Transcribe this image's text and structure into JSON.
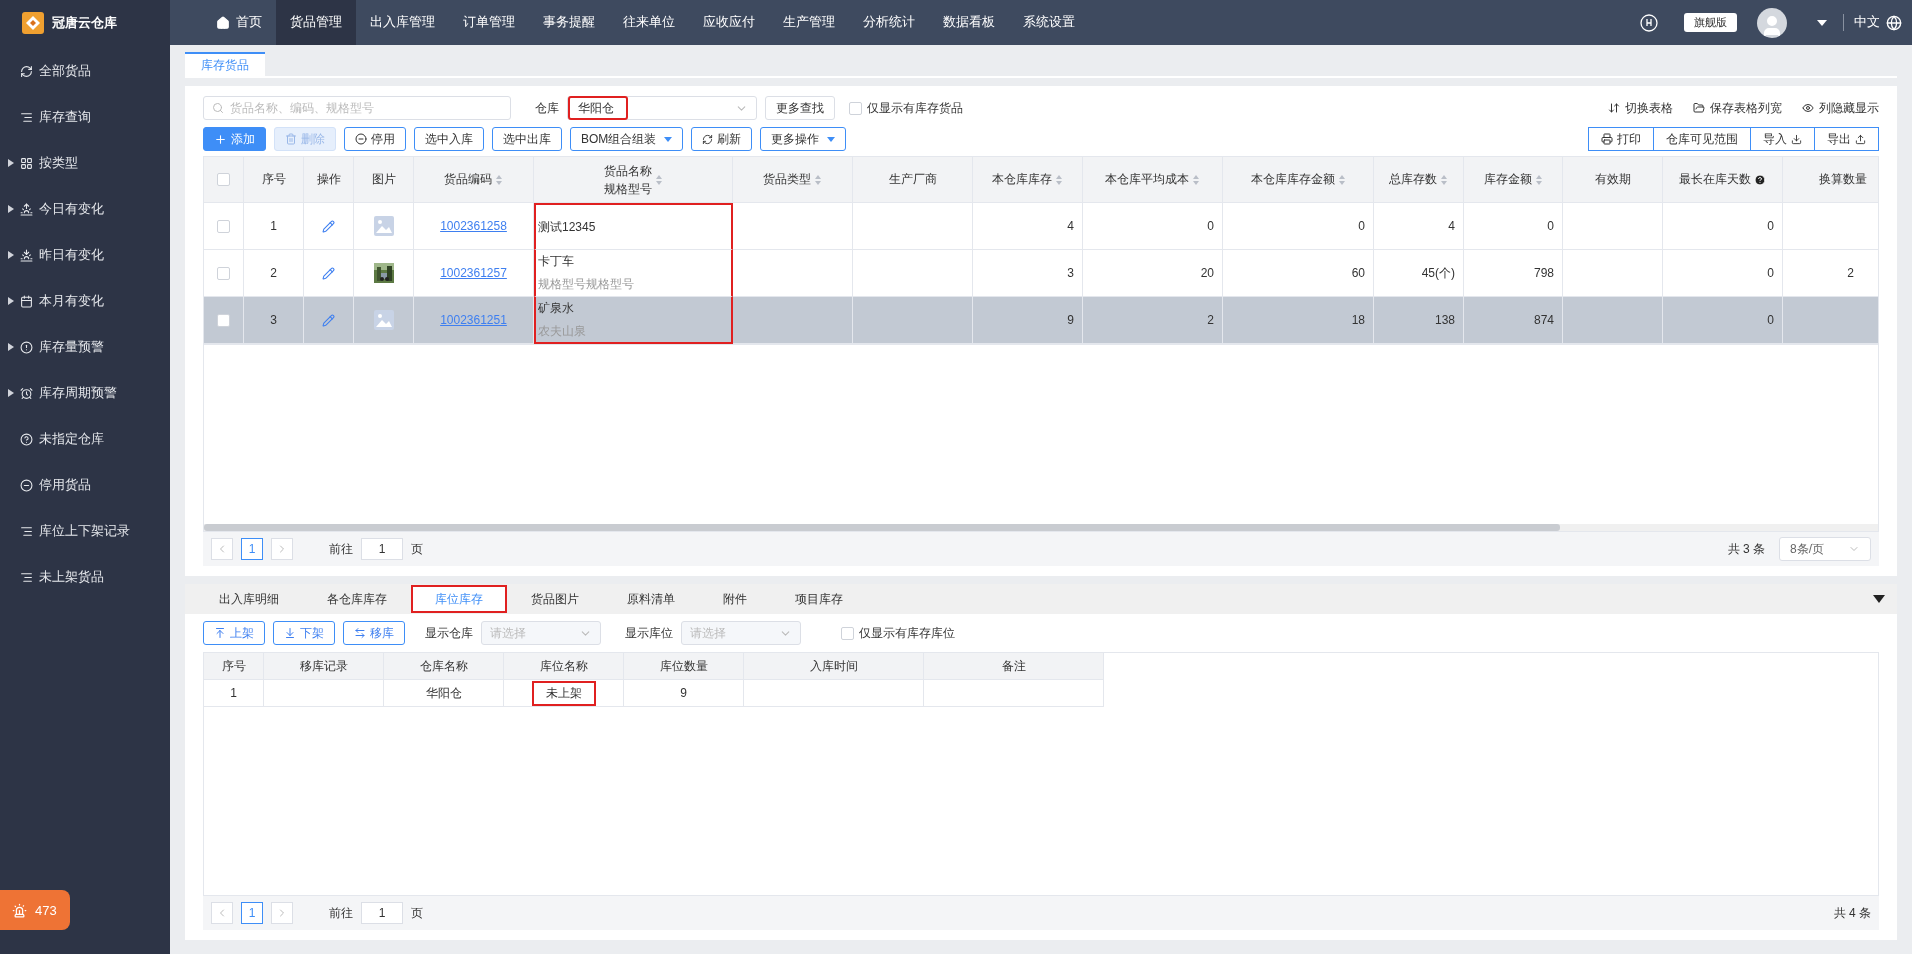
{
  "app": {
    "name": "冠唐云仓库"
  },
  "nav": [
    {
      "label": "首页",
      "selected": false,
      "kind": "home"
    },
    {
      "label": "货品管理",
      "selected": true
    },
    {
      "label": "出入库管理",
      "selected": false
    },
    {
      "label": "订单管理",
      "selected": false
    },
    {
      "label": "事务提醒",
      "selected": false
    },
    {
      "label": "往来单位",
      "selected": false
    },
    {
      "label": "应收应付",
      "selected": false
    },
    {
      "label": "生产管理",
      "selected": false
    },
    {
      "label": "分析统计",
      "selected": false
    },
    {
      "label": "数据看板",
      "selected": false
    },
    {
      "label": "系统设置",
      "selected": false
    }
  ],
  "top_right": {
    "edition": "旗舰版",
    "language": "中文"
  },
  "sidebar": {
    "items": [
      {
        "label": "全部货品",
        "kind": "leaf"
      },
      {
        "label": "库存查询",
        "kind": "leaf"
      },
      {
        "label": "按类型",
        "kind": "group"
      },
      {
        "label": "今日有变化",
        "kind": "group"
      },
      {
        "label": "昨日有变化",
        "kind": "group"
      },
      {
        "label": "本月有变化",
        "kind": "group"
      },
      {
        "label": "库存量预警",
        "kind": "group"
      },
      {
        "label": "库存周期预警",
        "kind": "group"
      },
      {
        "label": "未指定仓库",
        "kind": "leaf"
      },
      {
        "label": "停用货品",
        "kind": "leaf"
      },
      {
        "label": "库位上下架记录",
        "kind": "leaf"
      },
      {
        "label": "未上架货品",
        "kind": "leaf"
      }
    ]
  },
  "alert_badge": {
    "count": "473"
  },
  "page_tabs": [
    {
      "label": "库存货品",
      "selected": true
    }
  ],
  "filters": {
    "search_placeholder": "货品名称、编码、规格型号",
    "warehouse_label": "仓库",
    "warehouse_value": "华阳仓",
    "warehouse_highlighted": true,
    "more_search": "更多查找",
    "stock_only": {
      "label": "仅显示有库存货品",
      "checked": false
    }
  },
  "top_links": [
    {
      "label": "切换表格",
      "kind": "switch"
    },
    {
      "label": "保存表格列宽",
      "kind": "save"
    },
    {
      "label": "列隐藏显示",
      "kind": "eye"
    }
  ],
  "actions": [
    {
      "label": "添加",
      "kind": "add"
    },
    {
      "label": "删除",
      "kind": "delete"
    },
    {
      "label": "停用",
      "kind": "stop"
    },
    {
      "label": "选中入库",
      "kind": "plain"
    },
    {
      "label": "选中出库",
      "kind": "plain"
    },
    {
      "label": "BOM组合组装",
      "kind": "dropdown"
    },
    {
      "label": "刷新",
      "kind": "refresh"
    },
    {
      "label": "更多操作",
      "kind": "dropdown"
    }
  ],
  "right_actions": [
    {
      "label": "打印",
      "kind": "print"
    },
    {
      "label": "仓库可见范围",
      "kind": "plain"
    },
    {
      "label": "导入",
      "kind": "import"
    },
    {
      "label": "导出",
      "kind": "export"
    }
  ],
  "table": {
    "name_column_highlighted": true,
    "header_checked": false,
    "columns": [
      {
        "label": "序号",
        "sortable": false
      },
      {
        "label": "操作",
        "sortable": false
      },
      {
        "label": "图片",
        "sortable": false
      },
      {
        "label": "货品编码",
        "sortable": true
      },
      {
        "label": "货品名称",
        "sub": "规格型号",
        "sortable": true
      },
      {
        "label": "货品类型",
        "sortable": true
      },
      {
        "label": "生产厂商",
        "sortable": false
      },
      {
        "label": "本仓库库存",
        "sortable": true
      },
      {
        "label": "本仓库平均成本",
        "sortable": true
      },
      {
        "label": "本仓库库存金额",
        "sortable": true
      },
      {
        "label": "总库存数",
        "sortable": true
      },
      {
        "label": "库存金额",
        "sortable": true
      },
      {
        "label": "有效期",
        "sortable": false
      },
      {
        "label": "最长在库天数",
        "sortable": false,
        "help": true
      },
      {
        "label": "换算数量",
        "sortable": false
      }
    ],
    "rows": [
      {
        "index": "1",
        "kind": "placeholder",
        "code": "1002361258",
        "name": "测试12345",
        "stock": "4",
        "avg_cost": "0",
        "stock_amount": "0",
        "total_stock": "4",
        "amount": "0",
        "max_days": "0",
        "checked": false,
        "selected": false
      },
      {
        "index": "2",
        "code": "1002361257",
        "name": "卡丁车",
        "spec": "规格型号规格型号",
        "stock": "3",
        "avg_cost": "20",
        "stock_amount": "60",
        "total_stock": "45(个)",
        "amount": "798",
        "max_days": "0",
        "conversion": "2",
        "checked": false,
        "selected": false
      },
      {
        "index": "3",
        "kind": "placeholder",
        "code": "1002361251",
        "name": "矿泉水",
        "spec": "农夫山泉",
        "stock": "9",
        "avg_cost": "2",
        "stock_amount": "18",
        "total_stock": "138",
        "amount": "874",
        "max_days": "0",
        "checked": false,
        "selected": true
      }
    ]
  },
  "pagination": {
    "page": "1",
    "goto_label": "前往",
    "goto_value": "1",
    "page_suffix": "页",
    "total": "共 3 条",
    "page_size": "8条/页"
  },
  "detail_tabs": [
    {
      "label": "出入库明细",
      "selected": false,
      "highlighted": false
    },
    {
      "label": "各仓库库存",
      "selected": false,
      "highlighted": false
    },
    {
      "label": "库位库存",
      "selected": true,
      "highlighted": true
    },
    {
      "label": "货品图片",
      "selected": false,
      "highlighted": false
    },
    {
      "label": "原料清单",
      "selected": false,
      "highlighted": false
    },
    {
      "label": "附件",
      "selected": false,
      "highlighted": false
    },
    {
      "label": "项目库存",
      "selected": false,
      "highlighted": false
    }
  ],
  "detail_toolbar": {
    "buttons": [
      {
        "label": "上架",
        "kind": "up"
      },
      {
        "label": "下架",
        "kind": "down"
      },
      {
        "label": "移库",
        "kind": "move"
      }
    ],
    "warehouse_label": "显示仓库",
    "warehouse_placeholder": "请选择",
    "location_label": "显示库位",
    "location_placeholder": "请选择",
    "stock_only": {
      "label": "仅显示有库存库位",
      "checked": false
    }
  },
  "detail_table": {
    "columns": [
      "序号",
      "移库记录",
      "仓库名称",
      "库位名称",
      "库位数量",
      "入库时间",
      "备注"
    ],
    "rows": [
      {
        "index": "1",
        "warehouse": "华阳仓",
        "location": "未上架",
        "quantity": "9",
        "location_highlighted": true
      }
    ]
  },
  "detail_pagination": {
    "page": "1",
    "goto_label": "前往",
    "goto_value": "1",
    "page_suffix": "页",
    "total": "共 4 条"
  }
}
